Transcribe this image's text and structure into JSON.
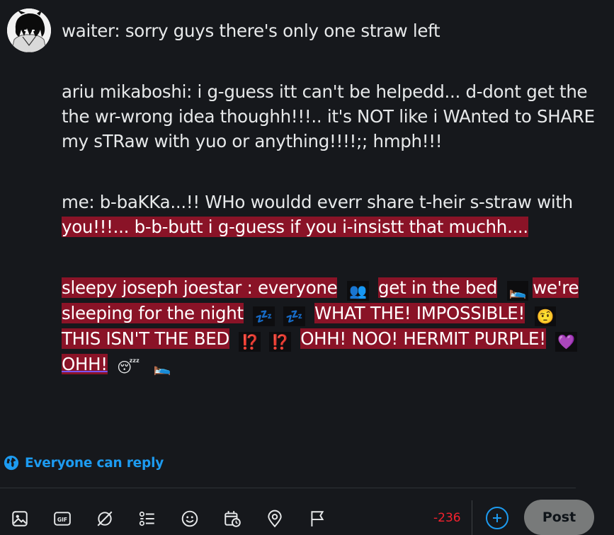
{
  "post": {
    "line1": "waiter: sorry guys there's only one straw left",
    "line2": "ariu mikaboshi: i g-guess itt can't be helpedd... d-dont get the the wr-wrong idea thoughh!!!.. it's NOT like i WAnted to SHARE my sTRaw with yuo or anything!!!!;; hmph!!!",
    "line3_plain": "me: b-baKKa...!! WHo wouldd everr share t-heir s-straw with",
    "line3_highlight": "you!!!... b-b-butt i g-guess if you i-insistt that muchh....",
    "line4": {
      "part1": "sleepy joseph joestar : everyone",
      "emoji_people": "👥",
      "part2": "get in the bed",
      "emoji_bed": "🛌",
      "part3": "we're sleeping for the night",
      "emoji_zzz": "💤",
      "part4": "WHAT THE! IMPOSSIBLE!",
      "emoji_raised_eyebrow": "🤨",
      "part5": "THIS ISN'T THE BED",
      "emoji_interrobang": "⁉️",
      "part6": "OHH! NOO! HERMIT PURPLE!",
      "emoji_purple_heart": "💜",
      "part7": "OHH!",
      "emoji_sleeping": "😴",
      "emoji_bed_end": "🛌"
    }
  },
  "reply_setting": {
    "label": "Everyone can reply",
    "icon": "globe-icon"
  },
  "toolbar": {
    "icons": [
      "image-icon",
      "gif-icon",
      "grok-icon",
      "poll-icon",
      "emoji-icon",
      "schedule-icon",
      "location-icon",
      "flag-icon"
    ],
    "gif_label": "GIF",
    "char_count": "-236",
    "add_icon": "plus-icon",
    "post_label": "Post"
  },
  "colors": {
    "background": "#16181c",
    "highlight": "#8a1327",
    "accent": "#1d9bf0",
    "count_over": "#f4212e",
    "post_button_disabled": "#787a7a"
  }
}
